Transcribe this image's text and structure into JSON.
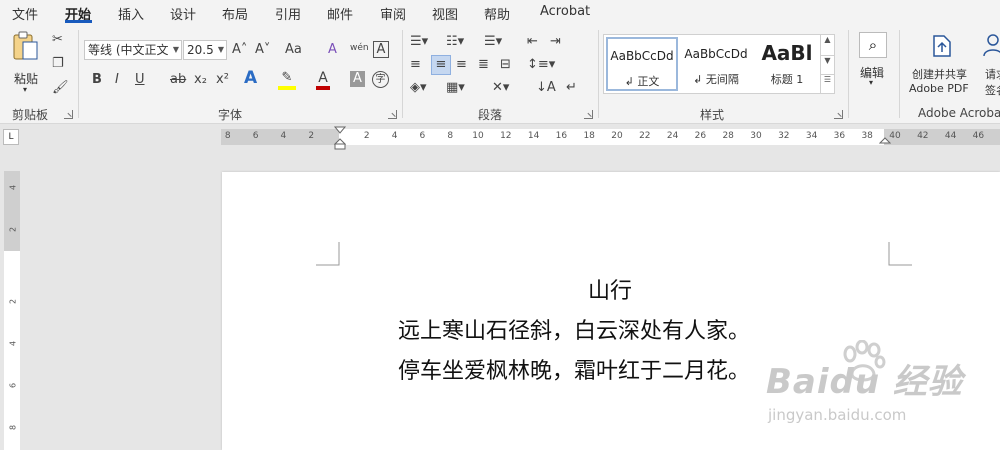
{
  "menu": {
    "tabs": [
      "文件",
      "开始",
      "插入",
      "设计",
      "布局",
      "引用",
      "邮件",
      "审阅",
      "视图",
      "帮助",
      "Acrobat"
    ],
    "active_tab": "开始"
  },
  "ribbon": {
    "clipboard": {
      "paste_label": "粘贴",
      "group_label": "剪贴板"
    },
    "font": {
      "font_name": "等线 (中文正文",
      "font_size": "20.5",
      "group_label": "字体",
      "icons": [
        "grow-font-icon",
        "shrink-font-icon",
        "change-case-icon",
        "clear-format-icon",
        "phonetic-guide-icon",
        "char-border-icon",
        "bold-icon",
        "italic-icon",
        "underline-icon",
        "strikethrough-icon",
        "subscript-icon",
        "superscript-icon",
        "text-effects-icon",
        "highlight-icon",
        "font-color-icon",
        "char-shading-icon",
        "enclose-char-icon"
      ],
      "glyphs": {
        "grow": "A˄",
        "shrink": "A˅",
        "case": "Aa",
        "clear": "A",
        "phonetic": "wén",
        "border": "A",
        "bold": "B",
        "italic": "I",
        "underline": "U",
        "strike": "ab",
        "sub": "x₂",
        "sup": "x²",
        "effects": "A",
        "highlight": "✎",
        "color": "A",
        "shade": "A",
        "enclose": "字"
      }
    },
    "paragraph": {
      "group_label": "段落"
    },
    "styles": {
      "group_label": "样式",
      "items": [
        {
          "sample": "AaBbCcDd",
          "name": "↲ 正文"
        },
        {
          "sample": "AaBbCcDd",
          "name": "↲ 无间隔"
        },
        {
          "sample": "AaBl",
          "name": "标题 1"
        }
      ]
    },
    "editing": {
      "label": "编辑"
    },
    "acrobat": {
      "create_pdf_line1": "创建并共享",
      "create_pdf_line2": "Adobe PDF",
      "request_line1": "请求",
      "request_line2": "签名",
      "group_label": "Adobe Acrobat"
    }
  },
  "ruler": {
    "left_ticks": [
      "8",
      "6",
      "4",
      "2"
    ],
    "right_ticks": [
      "2",
      "4",
      "6",
      "8",
      "10",
      "12",
      "14",
      "16",
      "18",
      "20",
      "22",
      "24",
      "26",
      "28",
      "30",
      "32",
      "34",
      "36",
      "38",
      "40",
      "42",
      "44",
      "46"
    ],
    "vertical_ticks": [
      "4",
      "2",
      "2",
      "4",
      "6",
      "8"
    ],
    "tab_selector": "L"
  },
  "document": {
    "title": "山行",
    "line1": "远上寒山石径斜，白云深处有人家。",
    "line2": "停车坐爱枫林晚，霜叶红于二月花。"
  },
  "watermark": {
    "logo": "Baidu 经验",
    "sub": "jingyan.baidu.com"
  },
  "colors": {
    "accent": "#185abd",
    "highlight": "#ffff00",
    "font_color": "#c00000"
  }
}
